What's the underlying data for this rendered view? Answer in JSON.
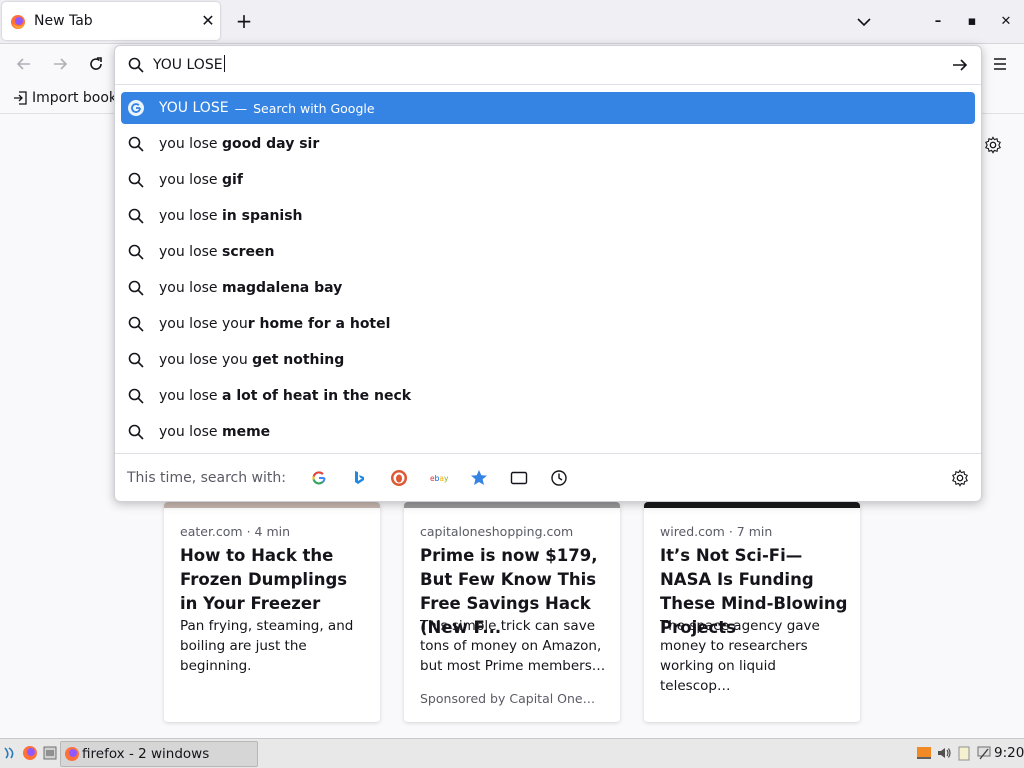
{
  "tab": {
    "title": "New Tab",
    "close_label": "✕"
  },
  "new_tab_label": "+",
  "window_controls": {
    "minimize": "–",
    "maximize": "▪",
    "close": "✕"
  },
  "bookmarks": {
    "import_label": "Import book"
  },
  "urlbar": {
    "value": "YOU LOSE",
    "selected": {
      "text": "YOU LOSE",
      "separator": "—",
      "action": "Search with Google"
    },
    "suggestions": [
      {
        "prefix": "you lose ",
        "bold": "good day sir"
      },
      {
        "prefix": "you lose ",
        "bold": "gif"
      },
      {
        "prefix": "you lose ",
        "bold": "in spanish"
      },
      {
        "prefix": "you lose ",
        "bold": "screen"
      },
      {
        "prefix": "you lose ",
        "bold": "magdalena bay"
      },
      {
        "prefix": "you lose you",
        "bold": "r home for a hotel"
      },
      {
        "prefix": "you lose you ",
        "bold": "get nothing"
      },
      {
        "prefix": "you lose ",
        "bold": "a lot of heat in the neck"
      },
      {
        "prefix": "you lose ",
        "bold": "meme"
      }
    ],
    "oneoff_label": "This time, search with:",
    "oneoff_engines": [
      "google",
      "bing",
      "duckduckgo",
      "ebay",
      "bookmarks",
      "tabs",
      "history"
    ]
  },
  "stories": [
    {
      "meta": "eater.com · 4 min",
      "headline": "How to Hack the Frozen Dumplings in Your Freezer",
      "desc": "Pan frying, steaming, and boiling are just the beginning.",
      "sponsor": ""
    },
    {
      "meta": "capitaloneshopping.com",
      "headline": "Prime is now $179, But Few Know This Free Savings Hack (New F...",
      "desc": "This simple trick can save tons of money on Amazon, but most Prime members…",
      "sponsor": "Sponsored by Capital One…"
    },
    {
      "meta": "wired.com · 7 min",
      "headline": "It’s Not Sci-Fi—NASA Is Funding These Mind-Blowing Projects",
      "desc": "The space agency gave money to researchers working on liquid telescop…",
      "sponsor": ""
    }
  ],
  "taskbar": {
    "task_label": "firefox - 2 windows",
    "clock": "9:20"
  },
  "colors": {
    "accent": "#3584e4",
    "tab_bg": "#f0f0f4",
    "page_bg": "#f9f9fb"
  }
}
